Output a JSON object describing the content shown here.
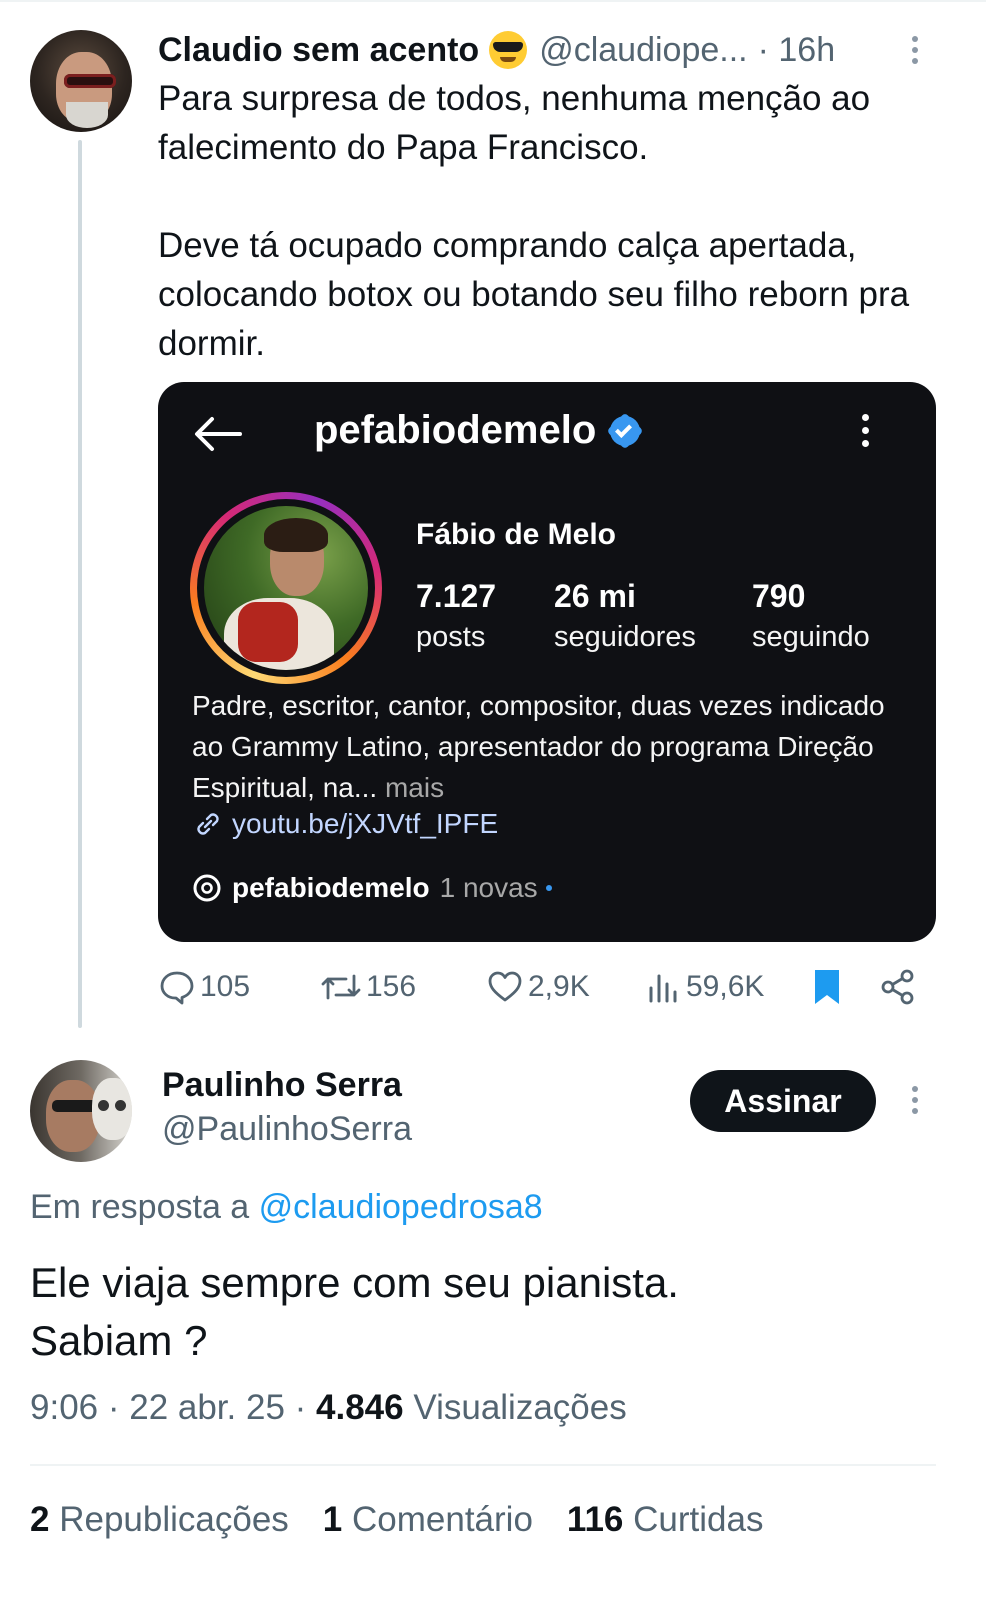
{
  "parent_tweet": {
    "author_name": "Claudio sem acento",
    "author_emoji": "sunglasses-emoji",
    "handle": "@claudiope...",
    "time": "· 16h",
    "text": "Para surpresa de todos, nenhuma menção ao falecimento do Papa Francisco.\n\nDeve tá ocupado comprando calça apertada, colocando botox ou botando seu filho reborn pra dormir.",
    "embed": {
      "username": "pefabiodemelo",
      "full_name": "Fábio de Melo",
      "stats": [
        {
          "value": "7.127",
          "label": "posts"
        },
        {
          "value": "26 mi",
          "label": "seguidores"
        },
        {
          "value": "790",
          "label": "seguindo"
        }
      ],
      "bio": "Padre, escritor, cantor, compositor, duas vezes indicado ao Grammy Latino, apresentador do programa Direção Espiritual, na...",
      "bio_more": "mais",
      "link": "youtu.be/jXJVtf_IPFE",
      "threads_name": "pefabiodemelo",
      "threads_new": "1 novas"
    },
    "actions": {
      "replies": "105",
      "reposts": "156",
      "likes": "2,9K",
      "views": "59,6K"
    }
  },
  "reply_tweet": {
    "author_name": "Paulinho Serra",
    "handle": "@PaulinhoSerra",
    "follow_label": "Assinar",
    "reply_prefix": "Em resposta a",
    "reply_mention": "@claudiopedrosa8",
    "text": "Ele viaja sempre com seu pianista.\nSabiam ?",
    "time": "9:06 · 22 abr. 25 ·",
    "views_count": "4.846",
    "views_label": "Visualizações",
    "stats": {
      "reposts_count": "2",
      "reposts_label": "Republicações",
      "comments_count": "1",
      "comments_label": "Comentário",
      "likes_count": "116",
      "likes_label": "Curtidas"
    }
  },
  "colors": {
    "text": "#0f1419",
    "secondary": "#536471",
    "accent": "#1d9bf0",
    "embed_bg": "#0f1014",
    "bookmark": "#1d9bf0"
  }
}
